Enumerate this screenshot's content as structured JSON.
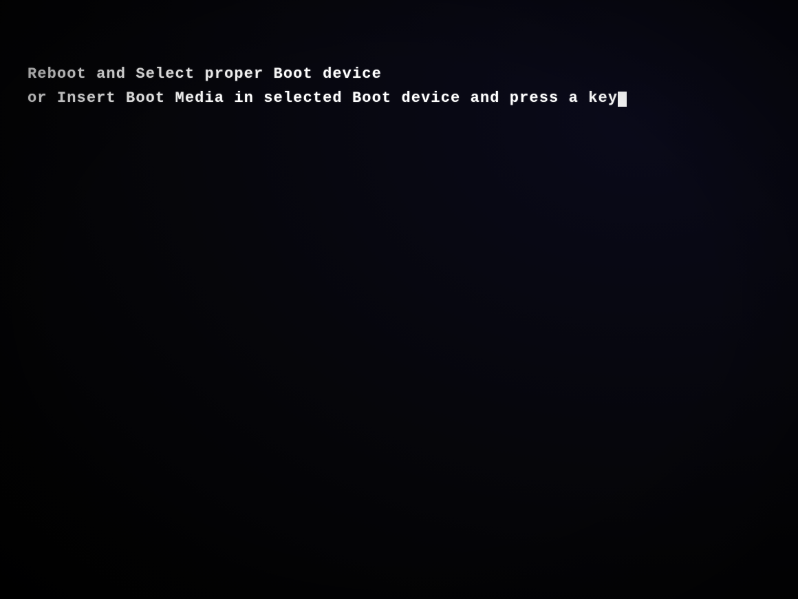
{
  "screen": {
    "background_color": "#050508",
    "text_color": "#ffffff"
  },
  "boot_message": {
    "line1": "Reboot and Select proper Boot device",
    "line2_prefix": "or Insert Boot Media in selected Boot device and press a key",
    "cursor_char": "_"
  }
}
